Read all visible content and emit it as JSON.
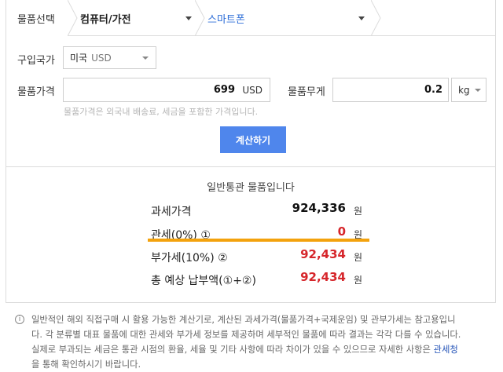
{
  "breadcrumb": {
    "first": "물품선택",
    "second": "컴퓨터/가전",
    "third": "스마트폰"
  },
  "form": {
    "country_label": "구입국가",
    "country_value": "미국",
    "country_currency": "USD",
    "price_label": "물품가격",
    "price_value": "699",
    "price_unit": "USD",
    "weight_label": "물품무게",
    "weight_value": "0.2",
    "weight_unit": "kg",
    "price_hint": "물품가격은 외국내 배송료, 세금을 포함한 가격입니다.",
    "calculate_label": "계산하기"
  },
  "result": {
    "title": "일반통관 물품입니다",
    "rows": [
      {
        "label": "과세가격",
        "value": "924,336",
        "unit": "원",
        "color": "#111111"
      },
      {
        "label": "관세(0%) ①",
        "value": "0",
        "unit": "원",
        "color": "#d6262b"
      },
      {
        "label": "부가세(10%) ②",
        "value": "92,434",
        "unit": "원",
        "color": "#d6262b"
      },
      {
        "label": "총 예상 납부액(①+②)",
        "value": "92,434",
        "unit": "원",
        "color": "#d6262b"
      }
    ],
    "highlight_color": "#f3a20d"
  },
  "notice": {
    "icon": "info-icon",
    "line1": "일반적인 해외 직접구매 시 활용 가능한 계산기로, 계산된 과세가격(물품가격+국제운임) 및 관부가세는 참고용입니",
    "line2": "다. 각 분류별 대표 물품에 대한 관세와 부가세 정보를 제공하며 세부적인 물품에 따라 결과는 각각 다를 수 있습니다.",
    "line3_before": "실제로 부과되는 세금은 통관 시점의 환율, 세율 및 기타 사항에 따라 차이가 있을 수 있으므로 자세한 사항은 ",
    "line3_link": "관세청",
    "line4": "을 통해 확인하시기 바랍니다."
  },
  "colors": {
    "accent": "#4f86ec",
    "link": "#2f6fd8",
    "value_red": "#d6262b"
  }
}
